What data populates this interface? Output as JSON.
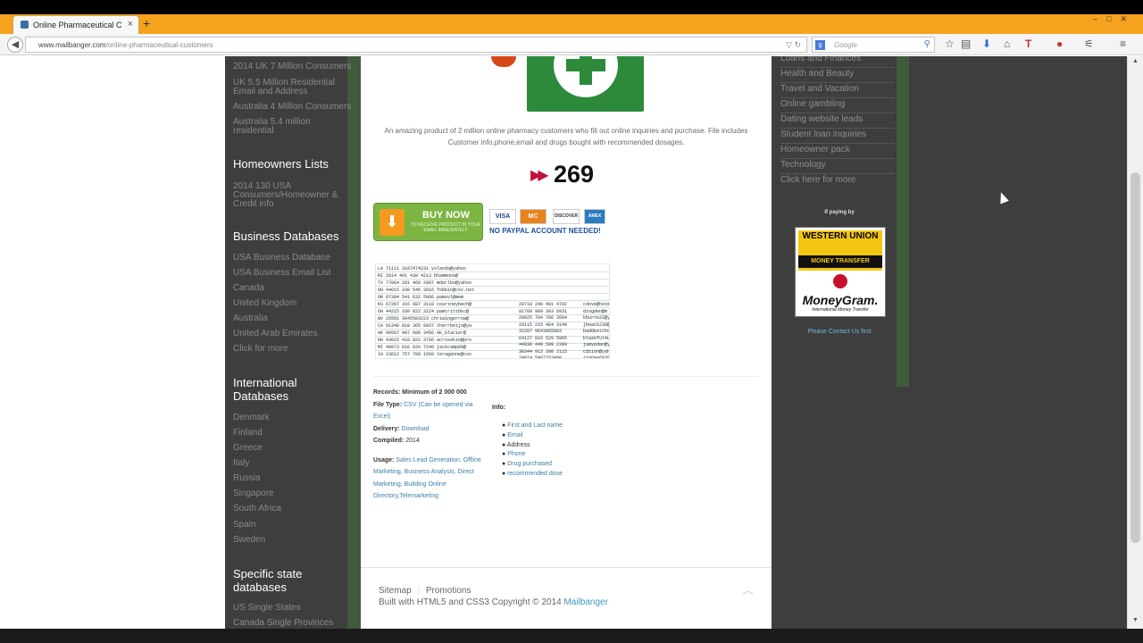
{
  "browser": {
    "tab_title": "Online Pharmaceutical Cus...",
    "tab_close": "×",
    "new_tab": "+",
    "url_host": "www.mailbanger.com",
    "url_path": "/online-pharmaceutical-customers",
    "search_placeholder": "Google",
    "window_controls": "–□✕"
  },
  "left_sidebar": {
    "top_links": [
      "2014 UK 7 Million Consumers",
      "UK 5.5 Million Residential Email and Address",
      "Australia 4 Million Consumers",
      "Australia 5.4 million residential"
    ],
    "homeowners_heading": "Homeowners Lists",
    "homeowners_link": "2014 130 USA Consumers/Homeowner & Credit info",
    "business_heading": "Business Databases",
    "business_links": [
      "USA Business Database",
      "USA Business Email List",
      "Canada",
      "United Kingdom",
      "Australia",
      "United Arab Emirates",
      "Click for more"
    ],
    "international_heading": "International Databases",
    "international_links": [
      "Denmark",
      "Finland",
      "Greece",
      "Italy",
      "Russia",
      "Singapore",
      "South Africa",
      "Spain",
      "Sweden"
    ],
    "state_heading": "Specific state databases",
    "state_links": [
      "US Single States",
      "Canada Single Provinces"
    ]
  },
  "product": {
    "description": "An amazing product of 2 million online pharmacy customers who fill out online inquiries and purchase. File includes Customer info,phone,email and drugs bought with recommended dosages.",
    "price": "269",
    "buy_now": "BUY NOW",
    "buy_sub": "TO RECEIVE PRODUCT IN YOUR EMAIL IMMEDIATELY",
    "cards": [
      "VISA",
      "MC",
      "DISCOVER",
      "AMEX"
    ],
    "no_paypal": "NO PAYPAL ACCOUNT NEEDED!",
    "records_label": "Records: Minimum of 2 000 000",
    "filetype_label": "File Type:",
    "filetype_value": "CSV (Can be opened via Excel)",
    "delivery_label": "Delivery:",
    "delivery_value": "Download",
    "compiled_label": "Compiled:",
    "compiled_value": "2014",
    "usage_label": "Usage:",
    "usage_value": "Sales Lead Generation, Offline Marketing, Business Analysis, Direct Marketing, Building Online Directory,Telemarketing",
    "info_label": "Info:",
    "info_items": [
      "First and Last name",
      "Email",
      "Address",
      "Phone",
      "Drug purchased",
      "recommended dose"
    ]
  },
  "footer": {
    "sitemap": "Sitemap",
    "promotions": "Promotions",
    "built_prefix": "Built with HTML5 and CSS3 Copyright © 2014 ",
    "brand": "Mailbanger"
  },
  "right_sidebar": {
    "links": [
      "Loans and Finances",
      "Health and Beauty",
      "Travel and Vacation",
      "Online gambling",
      "Dating website leads",
      "Student loan inquiries",
      "Homeowner pack",
      "Technology",
      "Click here for more"
    ],
    "if_paying": "If paying by",
    "wu_name": "WESTERN UNION",
    "wu_transfer": "MONEY TRANSFER",
    "mg_name": "MoneyGram.",
    "mg_sub": "International Money Transfer",
    "contact": "Please Contact Us first"
  },
  "colors": {
    "sidebar_bg": "#3e3e3e",
    "sidebar_edge": "#405b3c",
    "tab_bar": "#f5a21e",
    "price_arrow": "#c0103a",
    "buy_button": "#7cb542"
  }
}
